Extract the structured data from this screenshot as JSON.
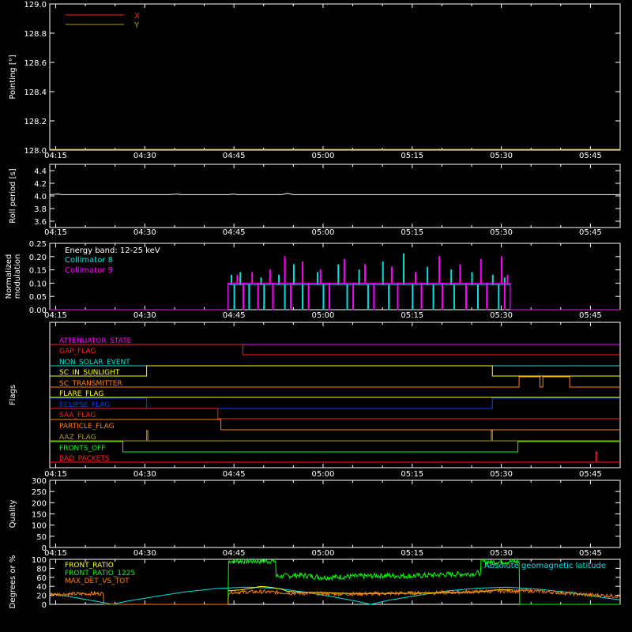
{
  "time_axis": {
    "start_min": 254,
    "end_min": 350,
    "ticks": [
      {
        "min": 255,
        "label": "04:15"
      },
      {
        "min": 270,
        "label": "04:30"
      },
      {
        "min": 285,
        "label": "04:45"
      },
      {
        "min": 300,
        "label": "05:00"
      },
      {
        "min": 315,
        "label": "05:15"
      },
      {
        "min": 330,
        "label": "05:30"
      },
      {
        "min": 345,
        "label": "05:45"
      }
    ]
  },
  "chart_data": [
    {
      "type": "line",
      "ylabel": "Pointing [°]",
      "ylim": [
        128.0,
        129.0
      ],
      "yticks": [
        "128.0",
        "128.2",
        "128.4",
        "128.6",
        "128.8",
        "129.0"
      ],
      "ytick_values": [
        128.0,
        128.2,
        128.4,
        128.6,
        128.8,
        129.0
      ],
      "legend": [
        {
          "name": "X",
          "color": "#ff2020"
        },
        {
          "name": "Y",
          "color": "#b0a000"
        }
      ],
      "series": [
        {
          "name": "X",
          "color": "#ff2020",
          "points": []
        },
        {
          "name": "Y",
          "color": "#b0a000",
          "points": [
            [
              254,
              128.0
            ],
            [
              350,
              128.0
            ]
          ]
        }
      ]
    },
    {
      "type": "line",
      "ylabel": "Roll period [s]",
      "ylim": [
        3.5,
        4.5
      ],
      "yticks": [
        "3.6",
        "3.8",
        "4.0",
        "4.2",
        "4.4"
      ],
      "ytick_values": [
        3.6,
        3.8,
        4.0,
        4.2,
        4.4
      ],
      "series": [
        {
          "name": "",
          "color": "#ffffff",
          "points": [
            [
              254,
              4.02
            ],
            [
              255.5,
              4.03
            ],
            [
              256,
              4.02
            ],
            [
              274,
              4.02
            ],
            [
              275.5,
              4.03
            ],
            [
              276,
              4.02
            ],
            [
              284,
              4.02
            ],
            [
              285,
              4.03
            ],
            [
              285.5,
              4.02
            ],
            [
              293,
              4.02
            ],
            [
              294,
              4.04
            ],
            [
              295,
              4.02
            ],
            [
              350,
              4.02
            ]
          ]
        }
      ]
    },
    {
      "type": "line",
      "ylabel": "Normalized modulation",
      "ylim": [
        0.0,
        0.25
      ],
      "yticks": [
        "0.00",
        "0.05",
        "0.10",
        "0.15",
        "0.20",
        "0.25"
      ],
      "ytick_values": [
        0.0,
        0.05,
        0.1,
        0.15,
        0.2,
        0.25
      ],
      "annotations": [
        "Energy band: 12-25 keV",
        "Collimator 8",
        "Collimator 9"
      ],
      "series": [
        {
          "name": "Collimator 8",
          "color": "#00e0e0",
          "active": [
            284.0,
            331.5
          ],
          "base": 0.095,
          "spikes": [
            [
              284.5,
              0.13
            ],
            [
              286.0,
              0.14
            ],
            [
              289.5,
              0.12
            ],
            [
              292.5,
              0.13
            ],
            [
              295.0,
              0.17
            ],
            [
              299.0,
              0.14
            ],
            [
              302.5,
              0.17
            ],
            [
              306.0,
              0.15
            ],
            [
              310.0,
              0.18
            ],
            [
              313.5,
              0.21
            ],
            [
              317.5,
              0.16
            ],
            [
              321.5,
              0.15
            ],
            [
              325.0,
              0.14
            ],
            [
              328.5,
              0.13
            ],
            [
              330.5,
              0.12
            ]
          ],
          "dips": [
            285.0,
            287.5,
            290.0,
            293.5,
            296.5,
            300.0,
            304.0,
            307.5,
            311.0,
            315.0,
            318.5,
            322.0,
            326.0,
            329.5
          ]
        },
        {
          "name": "Collimator 9",
          "color": "#ff00ff",
          "active": [
            284.0,
            331.5
          ],
          "base": 0.1,
          "spikes": [
            [
              285.5,
              0.13
            ],
            [
              288.0,
              0.14
            ],
            [
              291.0,
              0.15
            ],
            [
              293.5,
              0.2
            ],
            [
              296.5,
              0.18
            ],
            [
              299.5,
              0.15
            ],
            [
              303.5,
              0.19
            ],
            [
              307.0,
              0.17
            ],
            [
              311.5,
              0.16
            ],
            [
              315.5,
              0.14
            ],
            [
              319.5,
              0.2
            ],
            [
              323.0,
              0.17
            ],
            [
              326.5,
              0.19
            ],
            [
              330.0,
              0.2
            ],
            [
              331.0,
              0.13
            ]
          ],
          "dips": [
            286.5,
            289.0,
            291.5,
            294.5,
            297.5,
            301.0,
            305.0,
            308.5,
            312.5,
            316.5,
            320.0,
            324.0,
            327.5,
            330.5
          ]
        }
      ]
    },
    {
      "type": "line",
      "ylabel": "Flags",
      "flags": [
        {
          "name": "ATTENUATOR_STATE",
          "color": "#ff00ff",
          "steps": [
            [
              254,
              0
            ]
          ]
        },
        {
          "name": "GAP_FLAG",
          "color": "#ff2020",
          "steps": [
            [
              254,
              1
            ],
            [
              286.5,
              0
            ]
          ]
        },
        {
          "name": "NON_SOLAR_EVENT",
          "color": "#00e0e0",
          "steps": [
            [
              254,
              0
            ]
          ]
        },
        {
          "name": "SC_IN_SUNLIGHT",
          "color": "#ffff00",
          "steps": [
            [
              254,
              0
            ],
            [
              270.3,
              1
            ],
            [
              328.5,
              0
            ]
          ]
        },
        {
          "name": "SC_TRANSMITTER",
          "color": "#ff8000",
          "steps": [
            [
              254,
              0
            ],
            [
              333.0,
              1
            ],
            [
              336.5,
              0
            ],
            [
              337.0,
              1
            ],
            [
              341.5,
              0
            ]
          ]
        },
        {
          "name": "FLARE_FLAG",
          "color": "#ffff00",
          "steps": [
            [
              254,
              0
            ]
          ]
        },
        {
          "name": "ECLIPSE_FLAG",
          "color": "#0040ff",
          "steps": [
            [
              254,
              1
            ],
            [
              270.3,
              0
            ],
            [
              328.5,
              1
            ]
          ]
        },
        {
          "name": "SAA_FLAG",
          "color": "#ff2020",
          "steps": [
            [
              254,
              1
            ],
            [
              282.3,
              0
            ]
          ]
        },
        {
          "name": "PARTICLE_FLAG",
          "color": "#ff8000",
          "steps": [
            [
              254,
              1
            ],
            [
              282.8,
              0
            ]
          ]
        },
        {
          "name": "AAZ_FLAG",
          "color": "#b0a000",
          "steps": [
            [
              254,
              0
            ],
            [
              270.3,
              1
            ],
            [
              270.5,
              0
            ],
            [
              328.3,
              1
            ],
            [
              328.5,
              0
            ]
          ]
        },
        {
          "name": "FRONTS_OFF",
          "color": "#00ff00",
          "steps": [
            [
              254,
              1
            ],
            [
              266.3,
              0
            ],
            [
              332.8,
              1
            ]
          ]
        },
        {
          "name": "BAD_PACKETS",
          "color": "#ff2020",
          "steps": [
            [
              254,
              0
            ],
            [
              345.9,
              1
            ],
            [
              346.1,
              0
            ]
          ]
        }
      ]
    },
    {
      "type": "line",
      "ylabel": "Quality",
      "ylim": [
        0,
        300
      ],
      "yticks": [
        "0",
        "50",
        "100",
        "150",
        "200",
        "250",
        "300"
      ],
      "ytick_values": [
        0,
        50,
        100,
        150,
        200,
        250,
        300
      ],
      "series": []
    },
    {
      "type": "line",
      "ylabel": "Degrees or %",
      "ylim": [
        0,
        100
      ],
      "yticks": [
        "0",
        "20",
        "40",
        "60",
        "80",
        "100"
      ],
      "ytick_values": [
        0,
        20,
        40,
        60,
        80,
        100
      ],
      "legend": [
        {
          "name": "FRONT_RATIO",
          "color": "#ffff00"
        },
        {
          "name": "FRONT_RATIO_1225",
          "color": "#00ff00"
        },
        {
          "name": "MAX_DET_VS_TOT",
          "color": "#ff8000"
        }
      ],
      "annotation": "Absolute geomagnetic latitude",
      "annotation_color": "#00e0e0",
      "series": [
        {
          "name": "FRONT_RATIO",
          "color": "#ffff00",
          "points": [
            [
              284,
              30
            ],
            [
              286,
              32
            ],
            [
              288,
              36
            ],
            [
              289.5,
              40
            ],
            [
              291,
              38
            ],
            [
              293,
              34
            ],
            [
              294,
              29
            ],
            [
              296,
              27
            ],
            [
              300,
              26
            ],
            [
              305,
              24
            ],
            [
              310,
              24
            ],
            [
              315,
              25
            ],
            [
              320,
              26
            ],
            [
              325,
              27
            ],
            [
              328,
              30
            ],
            [
              330,
              33
            ],
            [
              332,
              32
            ]
          ]
        },
        {
          "name": "FRONT_RATIO_1225",
          "color": "#00ff00",
          "noise": 6,
          "points": [
            [
              284,
              0
            ],
            [
              284.1,
              96
            ],
            [
              292,
              96
            ],
            [
              292.1,
              62
            ],
            [
              296,
              65
            ],
            [
              300,
              60
            ],
            [
              305,
              62
            ],
            [
              310,
              64
            ],
            [
              315,
              63
            ],
            [
              320,
              66
            ],
            [
              325,
              68
            ],
            [
              326.5,
              70
            ],
            [
              326.6,
              94
            ],
            [
              333,
              95
            ],
            [
              333.1,
              0
            ],
            [
              350,
              0
            ]
          ]
        },
        {
          "name": "MAX_DET_VS_TOT",
          "color": "#ff8000",
          "noise": 4,
          "points": [
            [
              254,
              22
            ],
            [
              262,
              24
            ],
            [
              263,
              24
            ],
            [
              263.1,
              0
            ],
            [
              284,
              0
            ],
            [
              284.1,
              27
            ],
            [
              290,
              28
            ],
            [
              295,
              25
            ],
            [
              300,
              24
            ],
            [
              305,
              23
            ],
            [
              310,
              24
            ],
            [
              315,
              25
            ],
            [
              320,
              26
            ],
            [
              325,
              28
            ],
            [
              330,
              30
            ],
            [
              335,
              30
            ],
            [
              340,
              26
            ],
            [
              345,
              21
            ],
            [
              350,
              18
            ]
          ]
        },
        {
          "name": "Absolute geomagnetic latitude",
          "color": "#00e0e0",
          "points": [
            [
              254,
              24
            ],
            [
              257,
              18
            ],
            [
              260,
              11
            ],
            [
              263,
              4
            ],
            [
              264.5,
              0
            ],
            [
              267,
              7
            ],
            [
              272,
              18
            ],
            [
              277,
              28
            ],
            [
              282,
              35
            ],
            [
              287,
              38
            ],
            [
              292,
              36
            ],
            [
              297,
              27
            ],
            [
              302,
              16
            ],
            [
              306,
              6
            ],
            [
              308,
              0
            ],
            [
              311,
              9
            ],
            [
              316,
              20
            ],
            [
              321,
              30
            ],
            [
              326,
              36
            ],
            [
              331,
              38
            ],
            [
              336,
              34
            ],
            [
              341,
              27
            ],
            [
              346,
              17
            ],
            [
              350,
              10
            ]
          ]
        }
      ]
    }
  ]
}
